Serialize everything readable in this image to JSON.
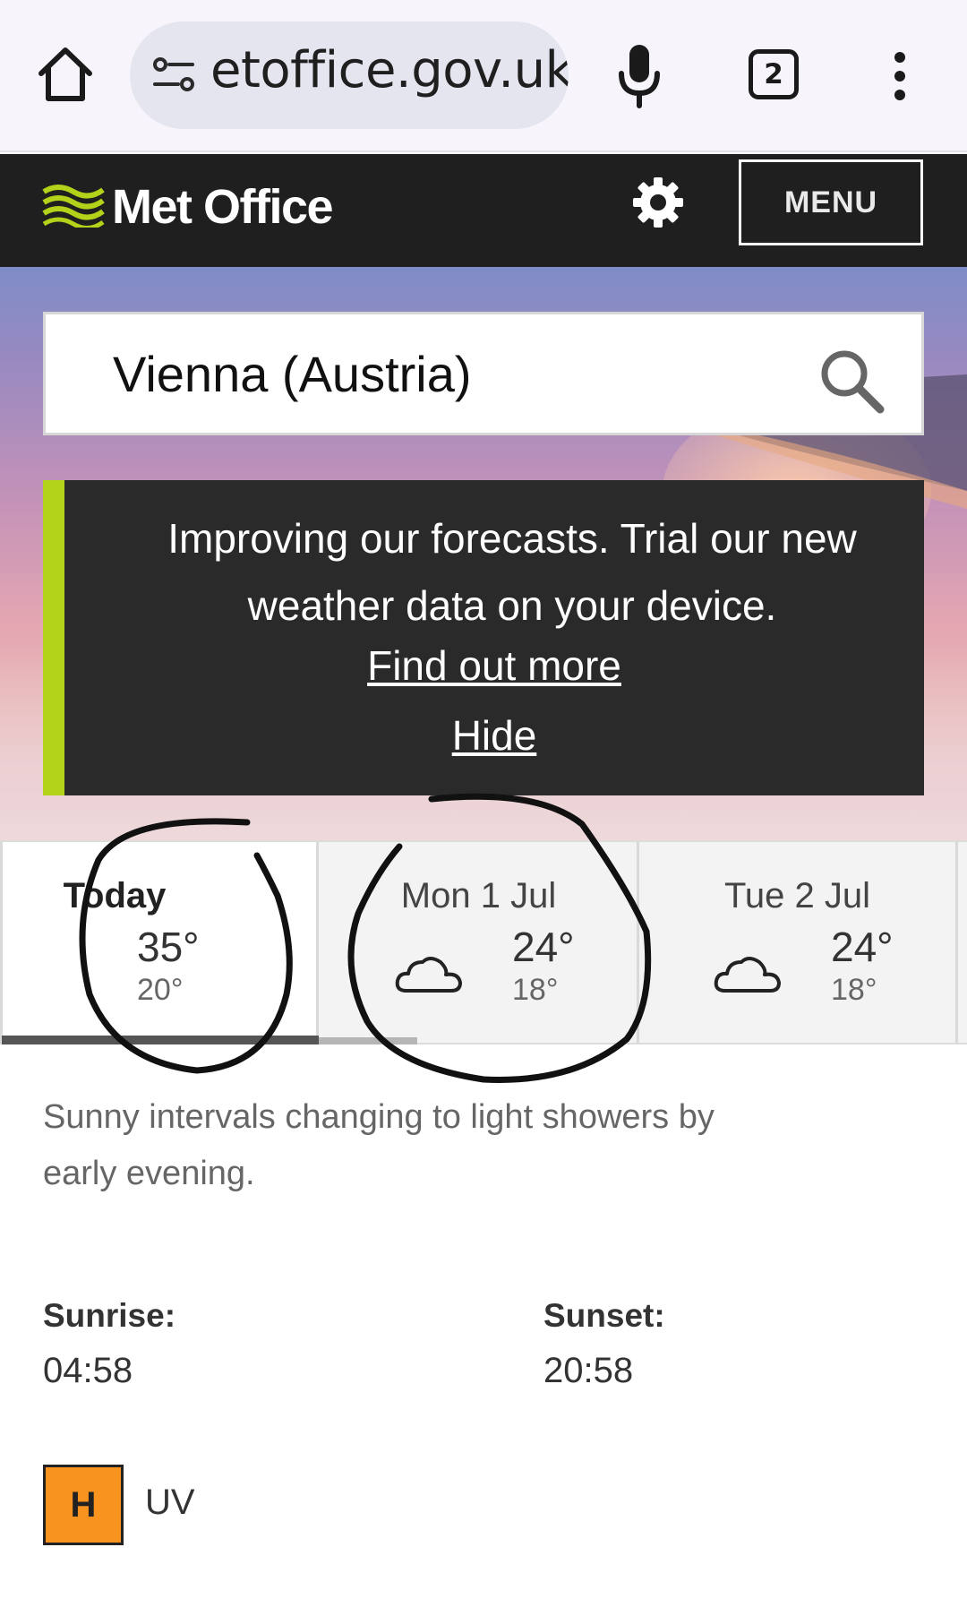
{
  "browser": {
    "url_display": "etoffice.gov.uk",
    "tab_count": "2",
    "icons": [
      "home-icon",
      "site-settings-icon",
      "mic-icon",
      "tabs-icon",
      "more-vert-icon"
    ]
  },
  "header": {
    "logo_text": "Met Office",
    "menu_label": "MENU",
    "icons": [
      "met-office-logo-icon",
      "gear-icon"
    ],
    "accent_color": "#b3d21a"
  },
  "search": {
    "value": "Vienna (Austria)"
  },
  "banner": {
    "message": "Improving our forecasts. Trial our new weather data on your device.",
    "find_out_more": "Find out more",
    "hide": "Hide"
  },
  "forecast": {
    "days": [
      {
        "name": "Today",
        "high": "35°",
        "low": "20°",
        "icon": null
      },
      {
        "name": "Mon 1 Jul",
        "high": "24°",
        "low": "18°",
        "icon": "cloud-icon"
      },
      {
        "name": "Tue 2 Jul",
        "high": "24°",
        "low": "18°",
        "icon": "cloud-icon"
      }
    ],
    "selected_index": 0
  },
  "details": {
    "summary": "Sunny intervals changing to light showers by early evening.",
    "sunrise_label": "Sunrise:",
    "sunrise_value": "04:58",
    "sunset_label": "Sunset:",
    "sunset_value": "20:58",
    "uv_badge": "H",
    "uv_label": "UV",
    "uv_color": "#f7931e"
  }
}
